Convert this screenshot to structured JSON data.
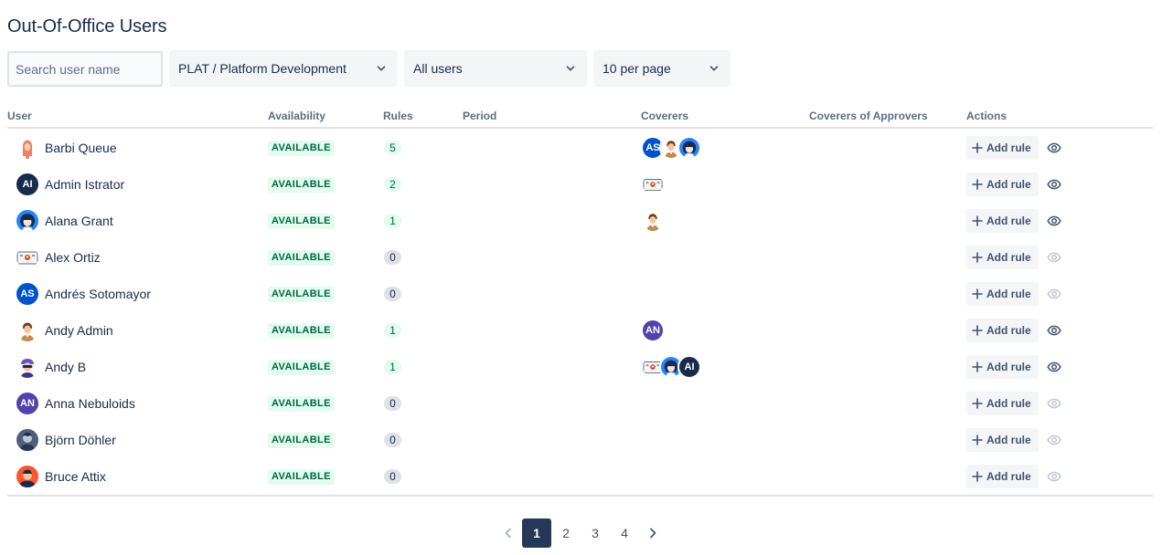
{
  "page": {
    "title": "Out-Of-Office Users"
  },
  "filters": {
    "search_placeholder": "Search user name",
    "project": "PLAT / Platform Development",
    "users": "All users",
    "per_page": "10 per page"
  },
  "table": {
    "headers": {
      "user": "User",
      "availability": "Availability",
      "rules": "Rules",
      "period": "Period",
      "coverers": "Coverers",
      "coverers_of_approvers": "Coverers of Approvers",
      "actions": "Actions"
    },
    "rows": [
      {
        "name": "Barbi Queue",
        "availability": "AVAILABLE",
        "rules": "5",
        "action": "Add rule"
      },
      {
        "name": "Admin Istrator",
        "availability": "AVAILABLE",
        "rules": "2",
        "action": "Add rule"
      },
      {
        "name": "Alana Grant",
        "availability": "AVAILABLE",
        "rules": "1",
        "action": "Add rule"
      },
      {
        "name": "Alex Ortiz",
        "availability": "AVAILABLE",
        "rules": "0",
        "action": "Add rule"
      },
      {
        "name": "Andrés Sotomayor",
        "availability": "AVAILABLE",
        "rules": "0",
        "action": "Add rule"
      },
      {
        "name": "Andy Admin",
        "availability": "AVAILABLE",
        "rules": "1",
        "action": "Add rule"
      },
      {
        "name": "Andy B",
        "availability": "AVAILABLE",
        "rules": "1",
        "action": "Add rule"
      },
      {
        "name": "Anna Nebuloids",
        "availability": "AVAILABLE",
        "rules": "0",
        "action": "Add rule"
      },
      {
        "name": "Björn Döhler",
        "availability": "AVAILABLE",
        "rules": "0",
        "action": "Add rule"
      },
      {
        "name": "Bruce Attix",
        "availability": "AVAILABLE",
        "rules": "0",
        "action": "Add rule"
      }
    ],
    "initials": {
      "AI": "AI",
      "AS": "AS",
      "AN": "AN"
    }
  },
  "pagination": {
    "pages": [
      "1",
      "2",
      "3",
      "4"
    ],
    "current": "1"
  },
  "colors": {
    "available_bg": "#e3fcef",
    "available_text": "#006644",
    "zero_badge": "#dfe1e6",
    "pager_active": "#253858",
    "avatar_ai": "#172b4d",
    "avatar_as": "#0052cc",
    "avatar_an": "#5243aa"
  }
}
